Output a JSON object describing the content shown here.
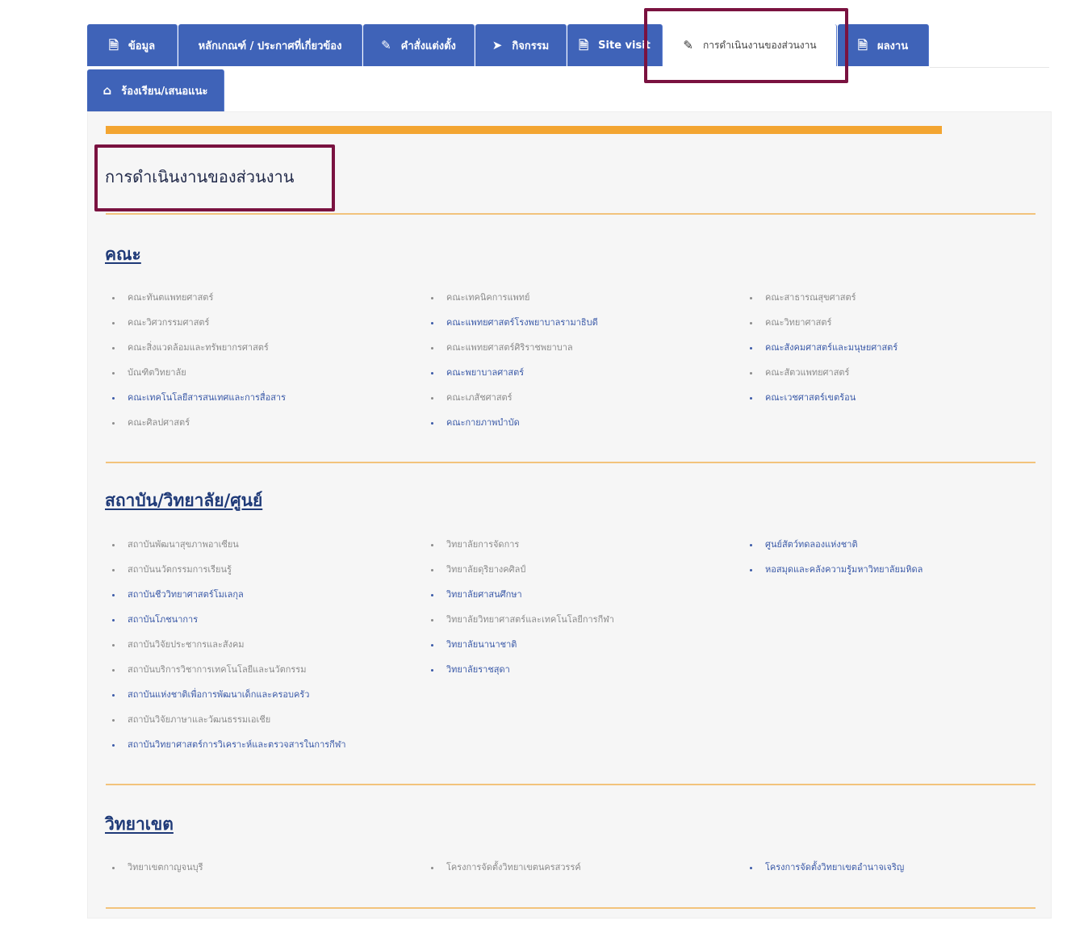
{
  "colors": {
    "tab_bg": "#3f63b8",
    "accent_orange": "#f3a531",
    "highlight": "#7a1240",
    "section_title": "#1f3a78"
  },
  "tabs": [
    {
      "label": "ข้อมูล",
      "icon": "document-icon"
    },
    {
      "label": "หลักเกณฑ์ / ประกาศที่เกี่ยวข้อง",
      "icon": ""
    },
    {
      "label": "คำสั่งแต่งตั้ง",
      "icon": "pen-icon"
    },
    {
      "label": "กิจกรรม",
      "icon": "send-icon"
    },
    {
      "label": "Site visit",
      "icon": "document-icon"
    },
    {
      "label": "การดำเนินงานของส่วนงาน",
      "icon": "pen-icon",
      "active": true
    },
    {
      "label": "ผลงาน",
      "icon": "document-icon"
    },
    {
      "label": "ร้องเรียน/เสนอแนะ",
      "icon": "home-icon"
    }
  ],
  "page_title": "การดำเนินงานของส่วนงาน",
  "sections": {
    "faculty": {
      "title": "คณะ",
      "col1": [
        "คณะทันตแพทยศาสตร์",
        "คณะวิศวกรรมศาสตร์",
        "คณะสิ่งแวดล้อมและทรัพยากรศาสตร์",
        "บัณฑิตวิทยาลัย",
        "คณะเทคโนโลยีสารสนเทศและการสื่อสาร",
        "คณะศิลปศาสตร์"
      ],
      "col2": [
        "คณะเทคนิคการแพทย์",
        "คณะแพทยศาสตร์โรงพยาบาลรามาธิบดี",
        "คณะแพทยศาสตร์ศิริราชพยาบาล",
        "คณะพยาบาลศาสตร์",
        "คณะเภสัชศาสตร์",
        "คณะกายภาพบำบัด"
      ],
      "col3": [
        "คณะสาธารณสุขศาสตร์",
        "คณะวิทยาศาสตร์",
        "คณะสังคมศาสตร์และมนุษยศาสตร์",
        "คณะสัตวแพทยศาสตร์",
        "คณะเวชศาสตร์เขตร้อน"
      ]
    },
    "institute": {
      "title": "สถาบัน/วิทยาลัย/ศูนย์",
      "col1": [
        "สถาบันพัฒนาสุขภาพอาเซียน",
        "สถาบันนวัตกรรมการเรียนรู้",
        "สถาบันชีววิทยาศาสตร์โมเลกุล",
        "สถาบันโภชนาการ",
        "สถาบันวิจัยประชากรและสังคม",
        "สถาบันบริการวิชาการเทคโนโลยีและนวัตกรรม",
        "สถาบันแห่งชาติเพื่อการพัฒนาเด็กและครอบครัว",
        "สถาบันวิจัยภาษาและวัฒนธรรมเอเชีย",
        "สถาบันวิทยาศาสตร์การวิเคราะห์และตรวจสารในการกีฬา"
      ],
      "col2": [
        "วิทยาลัยการจัดการ",
        "วิทยาลัยดุริยางคศิลป์",
        "วิทยาลัยศาสนศึกษา",
        "วิทยาลัยวิทยาศาสตร์และเทคโนโลยีการกีฬา",
        "วิทยาลัยนานาชาติ",
        "วิทยาลัยราชสุดา"
      ],
      "col3": [
        "ศูนย์สัตว์ทดลองแห่งชาติ",
        "หอสมุดและคลังความรู้มหาวิทยาลัยมหิดล"
      ]
    },
    "campus": {
      "title": "วิทยาเขต",
      "col1": [
        "วิทยาเขตกาญจนบุรี"
      ],
      "col2": [
        "โครงการจัดตั้งวิทยาเขตนครสวรรค์"
      ],
      "col3": [
        "โครงการจัดตั้งวิทยาเขตอำนาจเจริญ"
      ]
    }
  }
}
